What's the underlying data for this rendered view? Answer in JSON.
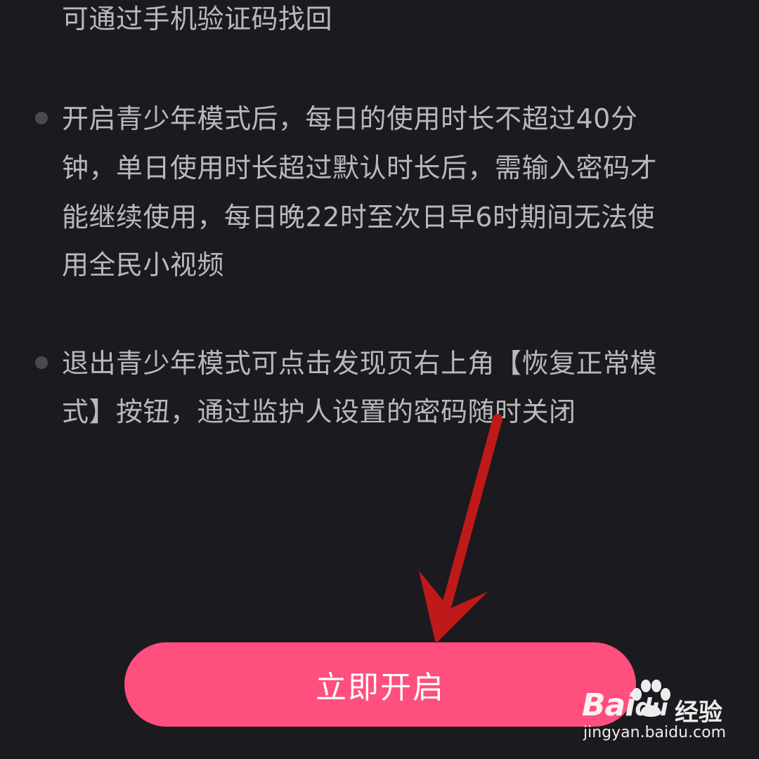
{
  "content": {
    "intro_line": "可通过手机验证码找回",
    "bullets": [
      {
        "lines": [
          "开启青少年模式后，每日的使用时长不超过40分",
          "钟，单日使用时长超过默认时长后，需输入密码才",
          "能继续使用，每日晚22时至次日早6时期间无法使",
          "用全民小视频"
        ]
      },
      {
        "lines": [
          "退出青少年模式可点击发现页右上角【恢复正常模",
          "式】按钮，通过监护人设置的密码随时关闭"
        ]
      }
    ]
  },
  "action": {
    "button_label": "立即开启"
  },
  "annotation": {
    "icon": "arrow-down-pointer-icon",
    "color": "#c0191a"
  },
  "watermark": {
    "brand": "Bai",
    "brand_suffix": "du",
    "sub": "经验",
    "url": "jingyan.baidu.com",
    "icon": "paw-icon"
  },
  "colors": {
    "background": "#1b1a1f",
    "text": "#b9b9bd",
    "bullet": "#4a494e",
    "button": "#fe4f7e",
    "button_text": "#ffffff"
  }
}
